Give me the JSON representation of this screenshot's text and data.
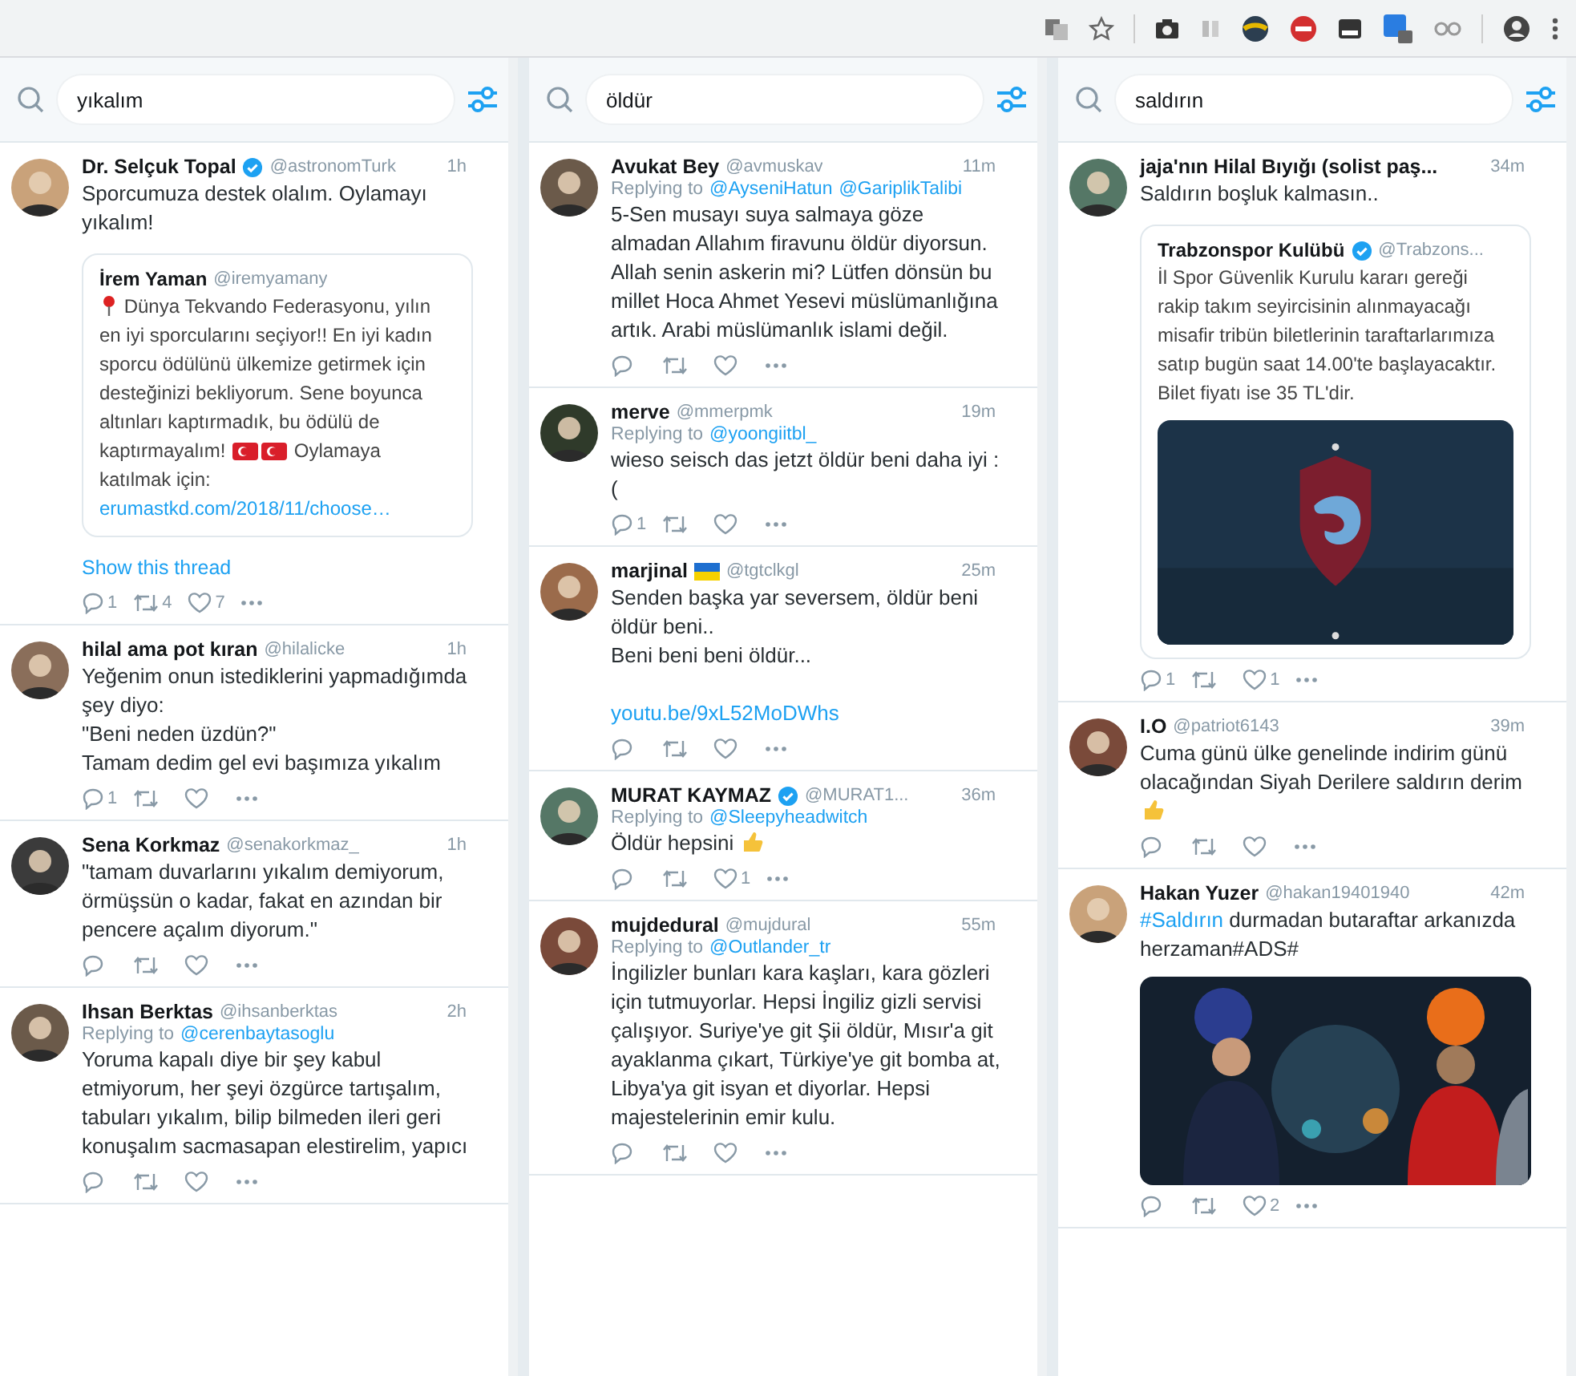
{
  "columns": [
    {
      "search": {
        "value": "yıkalım"
      },
      "tweets": [
        {
          "name": "Dr. Selçuk Topal",
          "verified": true,
          "handle": "@astronomTurk",
          "time": "1h",
          "body": [
            {
              "kind": "text",
              "text": "Sporcumuza destek olalım. Oylamayı yıkalım!"
            }
          ],
          "quote": {
            "name": "İrem Yaman",
            "verified": false,
            "handle": "@iremyamany",
            "body": [
              {
                "kind": "pin"
              },
              {
                "kind": "text",
                "text": " Dünya Tekvando Federasyonu, yılın en iyi sporcularını seçiyor!! En iyi kadın sporcu ödülünü ülkemize getirmek için desteğinizi bekliyorum. Sene boyunca altınları kaptırmadık, bu ödülü de kaptırmayalım! "
              },
              {
                "kind": "flag"
              },
              {
                "kind": "flag"
              },
              {
                "kind": "text",
                "text": " Oylamaya katılmak için: "
              },
              {
                "kind": "link",
                "text": "erumastkd.com/2018/11/choose…"
              }
            ]
          },
          "show_thread": "Show this thread",
          "replies": "1",
          "retweets": "4",
          "likes": "7"
        },
        {
          "name": "hilal ama pot kıran",
          "verified": false,
          "handle": "@hilalicke",
          "time": "1h",
          "body": [
            {
              "kind": "text",
              "text": "Yeğenim onun istediklerini yapmadığımda şey diyo:\n\"Beni neden üzdün?\"\nTamam dedim gel evi başımıza yıkalım"
            }
          ],
          "replies": "1"
        },
        {
          "name": "Sena Korkmaz",
          "verified": false,
          "handle": "@senakorkmaz_",
          "time": "1h",
          "body": [
            {
              "kind": "text",
              "text": "\"tamam duvarlarını yıkalım demiyorum, örmüşsün o kadar, fakat en azından bir pencere açalım diyorum.\""
            }
          ]
        },
        {
          "name": "Ihsan Berktas",
          "verified": false,
          "handle": "@ihsanberktas",
          "time": "2h",
          "replying_label": "Replying to",
          "replying_to": [
            "@cerenbaytasoglu"
          ],
          "body": [
            {
              "kind": "text",
              "text": "Yoruma kapalı diye bir şey kabul etmiyorum, her şeyi özgürce tartışalım, tabuları yıkalım, bilip bilmeden ileri geri konuşalım sacmasapan elestirelim, yapıcı"
            }
          ]
        }
      ]
    },
    {
      "search": {
        "value": "öldür"
      },
      "tweets": [
        {
          "name": "Avukat Bey",
          "verified": false,
          "handle": "@avmuskav",
          "time": "11m",
          "replying_label": "Replying to",
          "replying_to": [
            "@AyseniHatun",
            "@GariplikTalibi"
          ],
          "body": [
            {
              "kind": "text",
              "text": "5-Sen musayı suya salmaya göze almadan Allahım firavunu öldür diyorsun. Allah senin askerin mi? Lütfen dönsün bu millet Hoca Ahmet Yesevi müslümanlığına artık. Arabi müslümanlık islami değil."
            }
          ]
        },
        {
          "name": "merve",
          "verified": false,
          "handle": "@mmerpmk",
          "time": "19m",
          "replying_label": "Replying to",
          "replying_to": [
            "@yoongiitbl_"
          ],
          "body": [
            {
              "kind": "text",
              "text": "wieso seisch das jetzt öldür beni daha iyi :("
            }
          ],
          "replies": "1"
        },
        {
          "name": "marjinal",
          "verified": false,
          "name_flag": true,
          "handle": "@tgtclkgl",
          "time": "25m",
          "body": [
            {
              "kind": "text",
              "text": "Senden başka yar seversem, öldür beni öldür beni..\nBeni beni beni öldür...\n\n"
            },
            {
              "kind": "link",
              "text": "youtu.be/9xL52MoDWhs"
            }
          ]
        },
        {
          "name": "MURAT KAYMAZ",
          "verified": true,
          "handle": "@MURAT1...",
          "time": "36m",
          "replying_label": "Replying to",
          "replying_to": [
            "@Sleepyheadwitch"
          ],
          "body": [
            {
              "kind": "text",
              "text": "Öldür hepsini "
            },
            {
              "kind": "emoji"
            }
          ],
          "likes": "1"
        },
        {
          "name": "mujdedural",
          "verified": false,
          "handle": "@mujdural",
          "time": "55m",
          "replying_label": "Replying to",
          "replying_to": [
            "@Outlander_tr"
          ],
          "body": [
            {
              "kind": "text",
              "text": "İngilizler bunları kara kaşları, kara gözleri için tutmuyorlar. Hepsi İngiliz gizli servisi çalışıyor. Suriye'ye git Şii öldür, Mısır'a git ayaklanma çıkart, Türkiye'ye git bomba at, Libya'ya git isyan et diyorlar. Hepsi majestelerinin emir kulu."
            }
          ]
        }
      ]
    },
    {
      "search": {
        "value": "saldırın"
      },
      "tweets": [
        {
          "name": "jaja'nın Hilal Bıyığı (solist paş...",
          "verified": false,
          "time": "34m",
          "body": [
            {
              "kind": "text",
              "text": "Saldırın boşluk kalmasın.."
            }
          ],
          "quote": {
            "name": "Trabzonspor Kulübü",
            "verified": true,
            "handle": "@Trabzons...",
            "body": [
              {
                "kind": "text",
                "text": "İl Spor Güvenlik Kurulu kararı gereği rakip takım seyircisinin alınmayacağı misafir tribün biletlerinin taraftarlarımıza satıp bugün saat 14.00'te başlayacaktır. Bilet fiyatı ise 35 TL'dir."
              }
            ],
            "media": {
              "kind": "picture"
            }
          },
          "replies": "1",
          "likes": "1"
        },
        {
          "name": "I.O",
          "verified": false,
          "handle": "@patriot6143",
          "time": "39m",
          "body": [
            {
              "kind": "text",
              "text": "Cuma günü ülke genelinde indirim günü olacağından Siyah Derilere saldırın derim "
            },
            {
              "kind": "emoji"
            }
          ]
        },
        {
          "name": "Hakan Yuzer",
          "verified": false,
          "handle": "@hakan19401940",
          "time": "42m",
          "body": [
            {
              "kind": "link",
              "text": "#Saldırın"
            },
            {
              "kind": "text",
              "text": " durmadan butaraftar arkanızda herzaman#ADS#"
            }
          ],
          "media": {
            "kind": "picture"
          },
          "likes": "2"
        }
      ]
    }
  ]
}
